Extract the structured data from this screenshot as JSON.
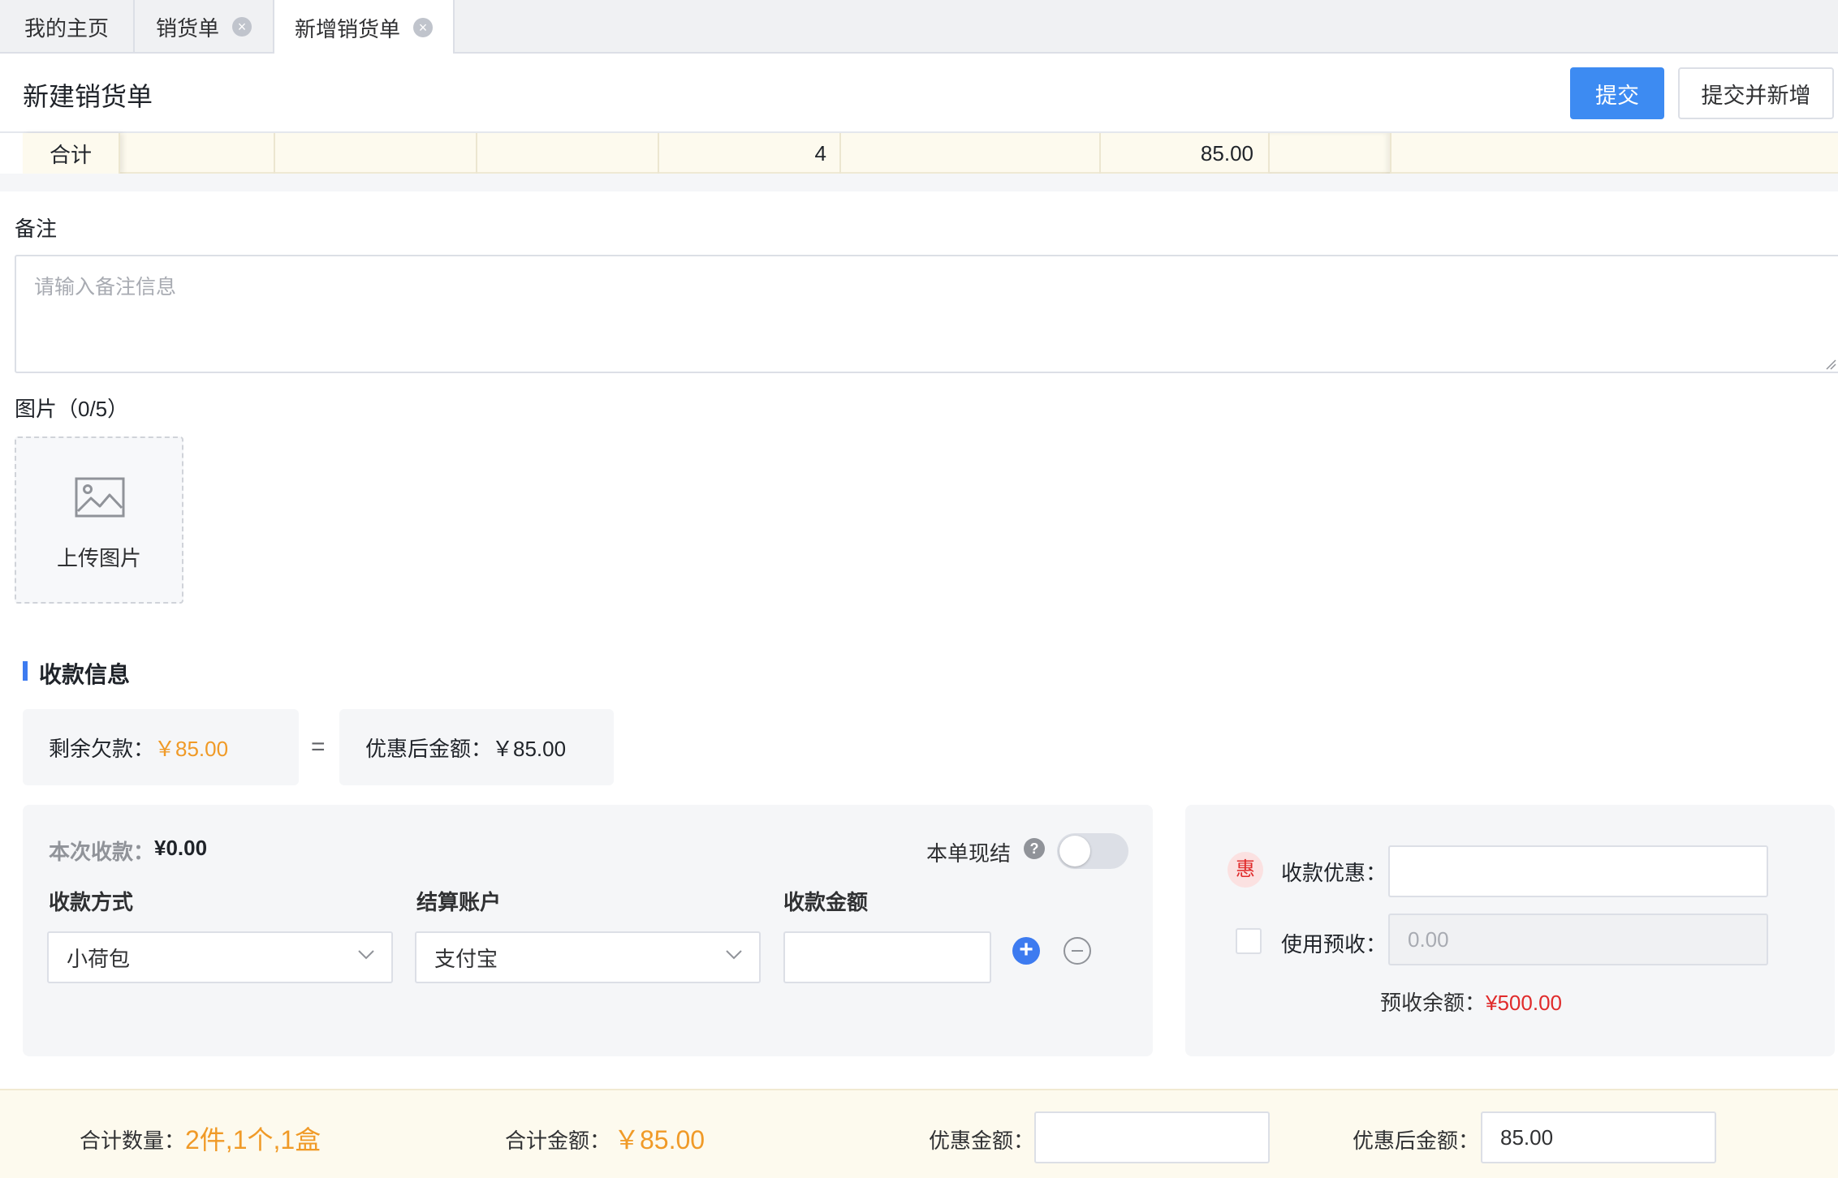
{
  "tabs": [
    {
      "label": "我的主页",
      "closable": false,
      "active": false
    },
    {
      "label": "销货单",
      "closable": true,
      "active": false
    },
    {
      "label": "新增销货单",
      "closable": true,
      "active": true
    }
  ],
  "header": {
    "title": "新建销货单",
    "submit_label": "提交",
    "submit_new_label": "提交并新增"
  },
  "totals_row": {
    "label": "合计",
    "quantity": "4",
    "amount": "85.00"
  },
  "remark": {
    "label": "备注",
    "placeholder": "请输入备注信息"
  },
  "images": {
    "label": "图片（0/5）",
    "upload_label": "上传图片",
    "icon": "image-icon"
  },
  "payment": {
    "section_title": "收款信息",
    "owed_label": "剩余欠款：",
    "owed_value": "￥85.00",
    "equals": "=",
    "after_discount_label": "优惠后金额：",
    "after_discount_value": "￥85.00",
    "this_payment_label": "本次收款：",
    "this_payment_value": "¥0.00",
    "settle_label": "本单现结",
    "settle_enabled": false,
    "columns": {
      "method": "收款方式",
      "account": "结算账户",
      "amount": "收款金额"
    },
    "method_value": "小荷包",
    "account_value": "支付宝",
    "amount_value": ""
  },
  "discount": {
    "badge": "惠",
    "discount_label": "收款优惠：",
    "discount_value": "",
    "use_prepaid_label": "使用预收：",
    "use_prepaid_checked": false,
    "prepaid_value": "0.00",
    "balance_label": "预收余额：",
    "balance_value": "¥500.00"
  },
  "footer": {
    "total_qty_label": "合计数量：",
    "total_qty_value": "2件,1个,1盒",
    "total_amount_label": "合计金额：",
    "total_amount_value": "￥85.00",
    "discount_label": "优惠金额：",
    "discount_value": "",
    "after_label": "优惠后金额：",
    "after_value": "85.00"
  },
  "colors": {
    "primary": "#3d8bf2",
    "accent_orange": "#f09a27",
    "accent_red": "#e02b2b",
    "total_row_bg": "#fdfaee"
  }
}
